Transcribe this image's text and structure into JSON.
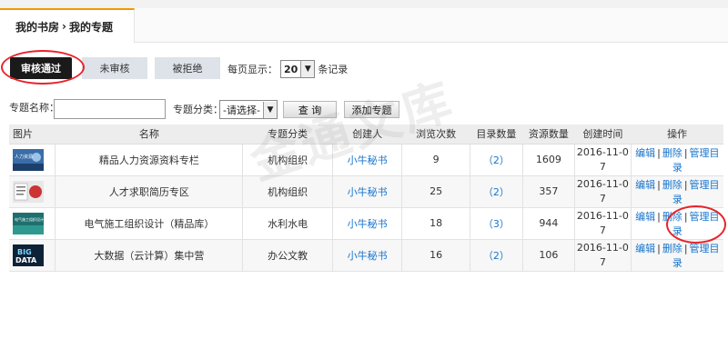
{
  "breadcrumb": {
    "part1": "我的书房",
    "sep": "›",
    "part2": "我的专题"
  },
  "tabs": [
    {
      "label": "审核通过",
      "active": true
    },
    {
      "label": "未审核",
      "active": false
    },
    {
      "label": "被拒绝",
      "active": false
    }
  ],
  "per_page": {
    "prefix": "每页显示：",
    "value": "20",
    "suffix": "条记录"
  },
  "filters": {
    "name_label": "专题名称：",
    "name_value": "",
    "category_label": "专题分类：",
    "category_value": "-请选择-",
    "search_btn": "查 询",
    "add_btn": "添加专题"
  },
  "table": {
    "headers": [
      "图片",
      "名称",
      "专题分类",
      "创建人",
      "浏览次数",
      "目录数量",
      "资源数量",
      "创建时间",
      "操作"
    ],
    "rows": [
      {
        "name": "精品人力资源资料专栏",
        "category": "机构组织",
        "creator": "小牛秘书",
        "views": "9",
        "dirs": "（2）",
        "resources": "1609",
        "date1": "2016-11-0",
        "date2": "7",
        "edit": "编辑",
        "del": "删除",
        "manage": "管理目录",
        "thumb_color": "#3a6ea8"
      },
      {
        "name": "人才求职简历专区",
        "category": "机构组织",
        "creator": "小牛秘书",
        "views": "25",
        "dirs": "（2）",
        "resources": "357",
        "date1": "2016-11-0",
        "date2": "7",
        "edit": "编辑",
        "del": "删除",
        "manage": "管理目录",
        "thumb_color": "#c33"
      },
      {
        "name": "电气施工组织设计（精品库）",
        "category": "水利水电",
        "creator": "小牛秘书",
        "views": "18",
        "dirs": "（3）",
        "resources": "944",
        "date1": "2016-11-0",
        "date2": "7",
        "edit": "编辑",
        "del": "删除",
        "manage": "管理目录",
        "thumb_color": "#1f6f6f"
      },
      {
        "name": "大数据（云计算）集中营",
        "category": "办公文教",
        "creator": "小牛秘书",
        "views": "16",
        "dirs": "（2）",
        "resources": "106",
        "date1": "2016-11-0",
        "date2": "7",
        "edit": "编辑",
        "del": "删除",
        "manage": "管理目录",
        "thumb_color": "#0d2236"
      }
    ]
  },
  "thumb_text": {
    "row1": "人力资源",
    "row3": "电气施工组织设计",
    "row4a": "BIG",
    "row4b": "DATA"
  },
  "watermark": "金通文库",
  "colors": {
    "accent": "#f39800",
    "link": "#1874cd",
    "highlight": "#e8232a",
    "active_tab": "#1a1a1a"
  }
}
